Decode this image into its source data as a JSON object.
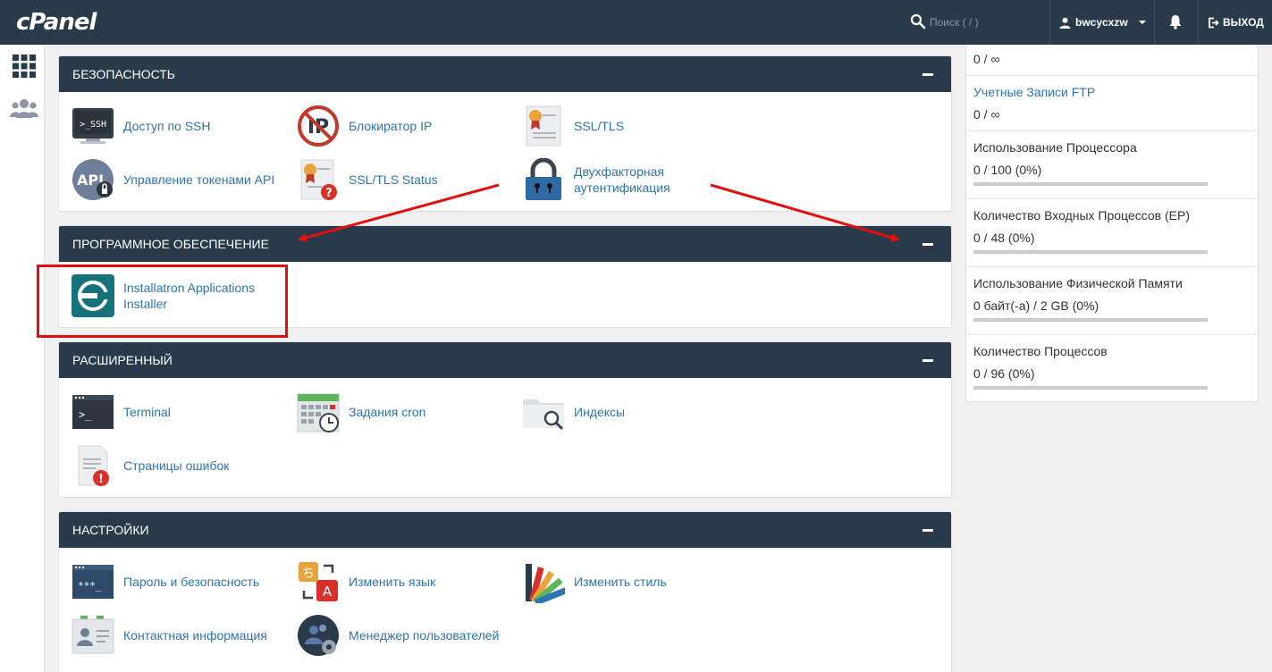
{
  "topbar": {
    "logo": "cPanel",
    "search_placeholder": "Поиск ( / )",
    "username": "bwcycxzw",
    "logout_label": "ВЫХОД"
  },
  "colors": {
    "header": "#293a4a",
    "link": "#2d74b4",
    "annotation": "#e01010"
  },
  "panels": {
    "security": {
      "title": "БЕЗОПАСНОСТЬ",
      "items": [
        {
          "label": "Доступ по SSH",
          "icon": "ssh-terminal-icon"
        },
        {
          "label": "Блокиратор IP",
          "icon": "ip-blocker-icon"
        },
        {
          "label": "SSL/TLS",
          "icon": "certificate-icon"
        },
        {
          "label": "Управление токенами API",
          "icon": "api-token-icon"
        },
        {
          "label": "SSL/TLS Status",
          "icon": "certificate-status-icon"
        },
        {
          "label": "Двухфакторная аутентификация",
          "icon": "padlock-icon"
        }
      ]
    },
    "software": {
      "title": "ПРОГРАММНОЕ ОБЕСПЕЧЕНИЕ",
      "items": [
        {
          "label": "Installatron Applications Installer",
          "icon": "installatron-icon"
        }
      ]
    },
    "advanced": {
      "title": "РАСШИРЕННЫЙ",
      "items": [
        {
          "label": "Terminal",
          "icon": "terminal-icon"
        },
        {
          "label": "Задания cron",
          "icon": "cron-calendar-icon"
        },
        {
          "label": "Индексы",
          "icon": "folder-search-icon"
        },
        {
          "label": "Страницы ошибок",
          "icon": "error-page-icon"
        }
      ]
    },
    "preferences": {
      "title": "НАСТРОЙКИ",
      "items": [
        {
          "label": "Пароль и безопасность",
          "icon": "password-icon"
        },
        {
          "label": "Изменить язык",
          "icon": "language-icon"
        },
        {
          "label": "Изменить стиль",
          "icon": "color-palette-icon"
        },
        {
          "label": "Контактная информация",
          "icon": "contact-card-icon"
        },
        {
          "label": "Менеджер пользователей",
          "icon": "user-manager-icon"
        }
      ]
    }
  },
  "stats": [
    {
      "title": "",
      "value": "0 / ∞"
    },
    {
      "title": "Учетные Записи FTP",
      "value": "0 / ∞",
      "link": true
    },
    {
      "title": "Использование Процессора",
      "value": "0 / 100   (0%)",
      "usage": 0
    },
    {
      "title": "Количество Входных Процессов (EP)",
      "value": "0 / 48   (0%)",
      "usage": 0
    },
    {
      "title": "Использование Физической Памяти",
      "value": "0 байт(-а) / 2 GB   (0%)",
      "usage": 0
    },
    {
      "title": "Количество Процессов",
      "value": "0 / 96   (0%)",
      "usage": 0
    }
  ]
}
